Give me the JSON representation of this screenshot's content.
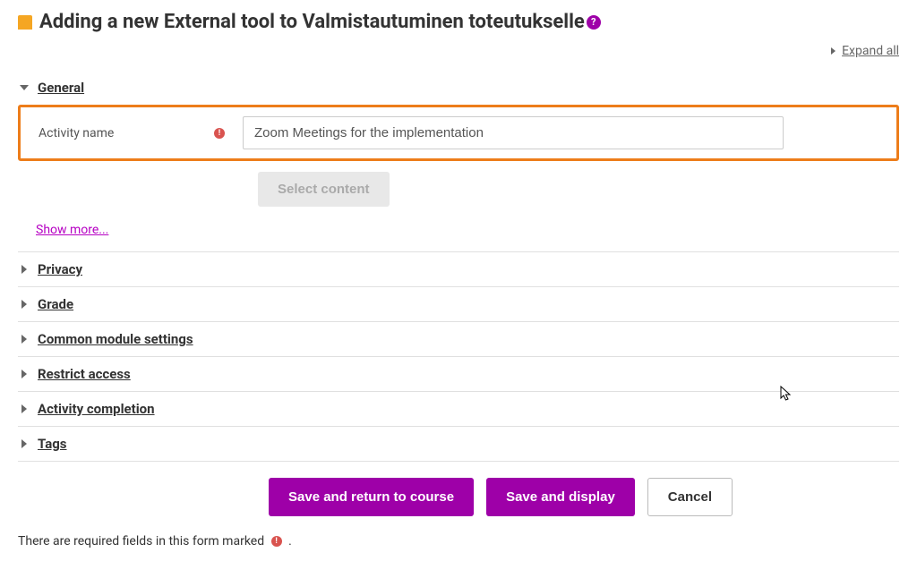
{
  "header": {
    "title": "Adding a new External tool to Valmistautuminen toteutukselle"
  },
  "expand_all_label": "Expand all",
  "sections": {
    "general": {
      "title": "General",
      "activity_name_label": "Activity name",
      "activity_name_value": "Zoom Meetings for the implementation",
      "select_content_label": "Select content",
      "show_more_label": "Show more..."
    },
    "privacy": {
      "title": "Privacy"
    },
    "grade": {
      "title": "Grade"
    },
    "common": {
      "title": "Common module settings"
    },
    "restrict": {
      "title": "Restrict access"
    },
    "completion": {
      "title": "Activity completion"
    },
    "tags": {
      "title": "Tags"
    }
  },
  "actions": {
    "save_return_label": "Save and return to course",
    "save_display_label": "Save and display",
    "cancel_label": "Cancel"
  },
  "footnote_text": "There are required fields in this form marked",
  "colors": {
    "accent": "#9e00a8",
    "highlight_border": "#ed7d1a",
    "required": "#d9534f",
    "tool_icon": "#f5a623"
  }
}
